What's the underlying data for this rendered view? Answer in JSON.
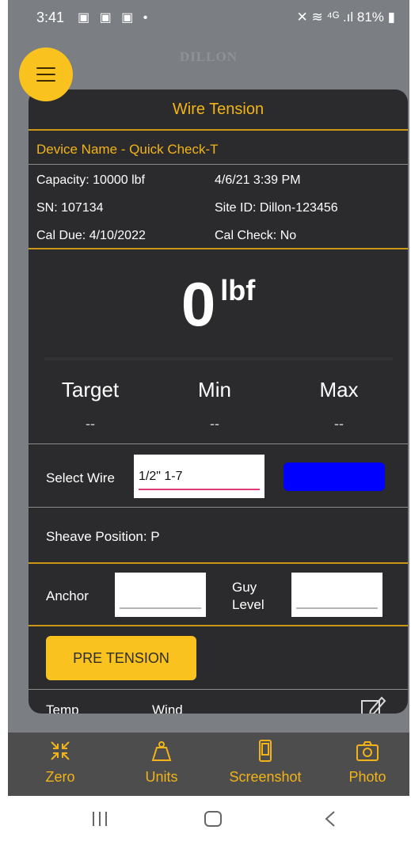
{
  "status_bar": {
    "time": "3:41",
    "left_icons": "▣ ▣ ▣ •",
    "right_icons": "✕ ≋ ⁴ᴳ .ıl",
    "battery": "81%"
  },
  "brand": "DILLON",
  "card": {
    "title": "Wire Tension",
    "device_name": "Device Name  -  Quick Check-T",
    "capacity": "Capacity: 10000 lbf",
    "datetime": "4/6/21 3:39 PM",
    "sn": "SN: 107134",
    "site_id": "Site ID: Dillon-123456",
    "cal_due": "Cal Due:  4/10/2022",
    "cal_check": "Cal Check: No"
  },
  "reading": {
    "value": "0",
    "unit": "lbf"
  },
  "stats": {
    "target": {
      "label": "Target",
      "value": "--"
    },
    "min": {
      "label": "Min",
      "value": "--"
    },
    "max": {
      "label": "Max",
      "value": "--"
    }
  },
  "select_wire": {
    "label": "Select Wire",
    "value": "1/2\" 1-7",
    "swatch_color": "#0000ff"
  },
  "sheave": {
    "text": "Sheave Position:  P"
  },
  "anchor": {
    "label": "Anchor",
    "value": ""
  },
  "guy_level": {
    "label_line1": "Guy",
    "label_line2": "Level",
    "value": ""
  },
  "pre_tension_button": "PRE TENSION",
  "partial_row": {
    "temp": "Temp",
    "wind": "Wind"
  },
  "bottom_nav": [
    {
      "label": "Zero",
      "icon": "collapse-arrows-icon"
    },
    {
      "label": "Units",
      "icon": "weight-icon"
    },
    {
      "label": "Screenshot",
      "icon": "phone-screenshot-icon"
    },
    {
      "label": "Photo",
      "icon": "camera-icon"
    }
  ],
  "colors": {
    "accent": "#f9c21f",
    "accent_text": "#f2b418",
    "card_bg": "#2b2b2d",
    "nav_bg": "#4d4d4d"
  }
}
